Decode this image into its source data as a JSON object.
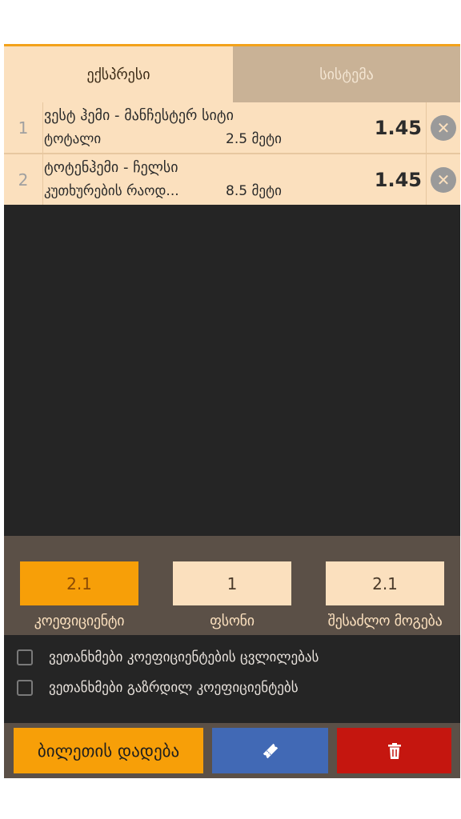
{
  "tabs": [
    {
      "label": "ექსპრესი",
      "active": true
    },
    {
      "label": "სისტემა",
      "active": false
    }
  ],
  "bets": [
    {
      "num": "1",
      "match": "ვესტ ჰემი - მანჩესტერ სიტი",
      "market": "ტოტალი",
      "line": "2.5 მეტი",
      "odds": "1.45"
    },
    {
      "num": "2",
      "match": "ტოტენჰემი - ჩელსი",
      "market": "კუთხურების რაოდ...",
      "line": "8.5 მეტი",
      "odds": "1.45"
    }
  ],
  "summary": {
    "coefficient_value": "2.1",
    "coefficient_label": "კოეფიციენტი",
    "stake_value": "1",
    "stake_label": "ფსონი",
    "possible_win_value": "2.1",
    "possible_win_label": "შესაძლო მოგება"
  },
  "agreements": [
    {
      "label": "ვეთანხმები კოეფიციენტების ცვლილებას",
      "checked": false
    },
    {
      "label": "ვეთანხმები გაზრდილ კოეფიციენტებს",
      "checked": false
    }
  ],
  "actions": {
    "place_bet_label": "ბილეთის დადება",
    "ticket_icon": "ticket-icon",
    "delete_icon": "trash-icon"
  },
  "colors": {
    "accent": "#f79f08",
    "tab_active": "#fbe0be",
    "tab_inactive": "#c9b296",
    "ticket_button": "#4169b5",
    "delete_button": "#c5160f"
  }
}
